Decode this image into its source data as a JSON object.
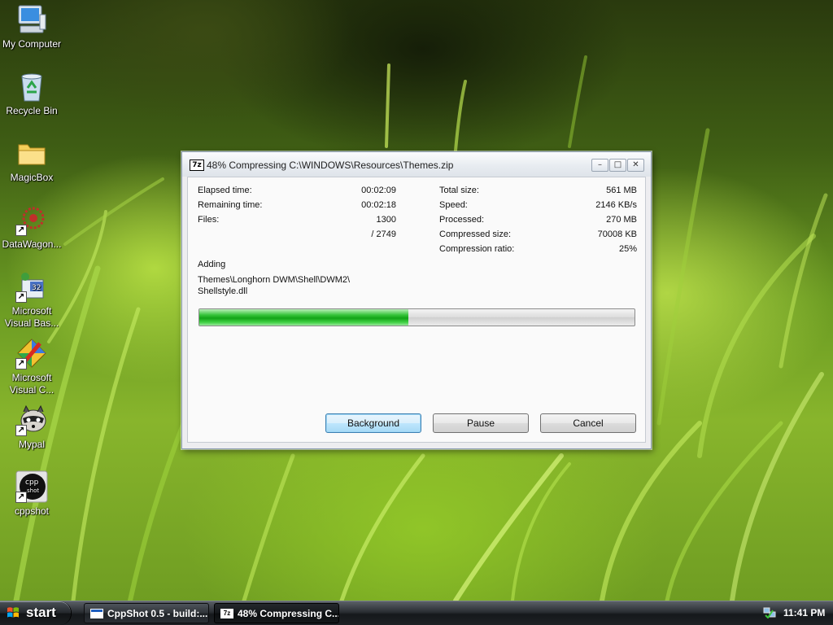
{
  "desktop": {
    "icons": [
      {
        "label": "My Computer"
      },
      {
        "label": "Recycle Bin"
      },
      {
        "label": "MagicBox"
      },
      {
        "label": "DataWagon..."
      },
      {
        "label": "Microsoft\nVisual Bas..."
      },
      {
        "label": "Microsoft\nVisual C..."
      },
      {
        "label": "Mypal"
      },
      {
        "label": "cppshot"
      }
    ]
  },
  "dialog": {
    "title_icon": "7z",
    "title": "48% Compressing C:\\WINDOWS\\Resources\\Themes.zip",
    "window_buttons": {
      "minimize": "–",
      "maximize": "□",
      "close": "✕"
    },
    "stats_left": [
      {
        "label": "Elapsed time:",
        "value": "00:02:09"
      },
      {
        "label": "Remaining time:",
        "value": "00:02:18"
      },
      {
        "label": "Files:",
        "value": "1300"
      },
      {
        "label": "",
        "value": "/ 2749"
      }
    ],
    "stats_right": [
      {
        "label": "Total size:",
        "value": "561 MB"
      },
      {
        "label": "Speed:",
        "value": "2146 KB/s"
      },
      {
        "label": "Processed:",
        "value": "270 MB"
      },
      {
        "label": "Compressed size:",
        "value": "70008 KB"
      },
      {
        "label": "Compression ratio:",
        "value": "25%"
      }
    ],
    "operation": "Adding",
    "current_file_line1": "Themes\\Longhorn DWM\\Shell\\DWM2\\",
    "current_file_line2": "Shellstyle.dll",
    "progress_percent": 48,
    "buttons": {
      "background": "Background",
      "pause": "Pause",
      "cancel": "Cancel"
    }
  },
  "taskbar": {
    "start_label": "start",
    "tasks": [
      {
        "label": "CppShot 0.5 - build:...",
        "icon": "window-icon"
      },
      {
        "label": "48% Compressing C...",
        "icon": "7zip-icon"
      }
    ],
    "clock": "11:41 PM",
    "tray_icon": "network-icon"
  },
  "colors": {
    "progress_fill": "#12a417",
    "default_button_border": "#3c7fb1",
    "taskbar": "#1e2125"
  }
}
